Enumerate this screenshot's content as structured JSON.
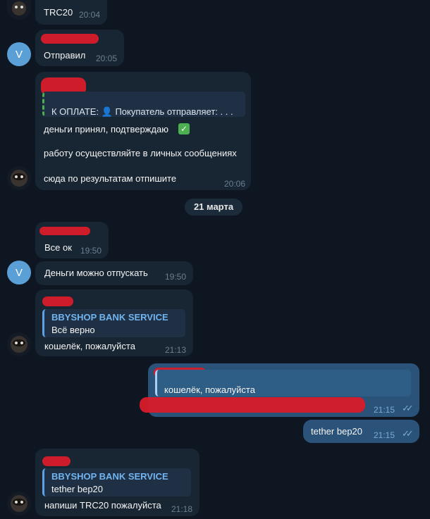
{
  "messages": {
    "m1": {
      "text": "TRC20",
      "time": "20:04"
    },
    "m2": {
      "text": "Отправил",
      "time": "20:05",
      "avatar_letter": "V"
    },
    "m3": {
      "quote_text": "К ОПЛАТЕ: 👤 Покупатель отправляет: . . .",
      "line1": "деньги принял, подтверждаю",
      "line2": "работу осуществляйте в личных сообщениях",
      "line3": "сюда по результатам отпишите",
      "time": "20:06"
    },
    "date": "21 марта",
    "m4": {
      "text": "Все ок",
      "time": "19:50"
    },
    "m5": {
      "text": "Деньги можно отпускать",
      "time": "19:50",
      "avatar_letter": "V"
    },
    "m6": {
      "quote_title": "BBYSHOP BANK SERVICE",
      "quote_text": "Всё верно",
      "text": "кошелёк, пожалуйста",
      "time": "21:13"
    },
    "m7": {
      "quote_text": "кошелёк, пожалуйста",
      "time": "21:15"
    },
    "m8": {
      "text": "tether bep20",
      "time": "21:15"
    },
    "m9": {
      "quote_title": "BBYSHOP BANK SERVICE",
      "quote_text": "tether bep20",
      "text": "напиши TRC20 пожалуйста",
      "time": "21:18"
    }
  },
  "colors": {
    "background": "#0e1621",
    "incoming_bubble": "#182533",
    "outgoing_bubble": "#2b5278",
    "accent": "#5ea1e4",
    "redaction": "#d81b2a"
  }
}
